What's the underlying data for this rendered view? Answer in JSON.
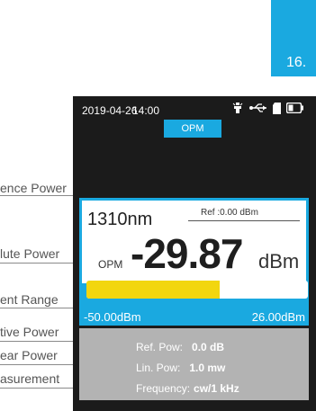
{
  "page": {
    "number": "16."
  },
  "callouts": [
    {
      "label": "ence Power"
    },
    {
      "label": "lute Power"
    },
    {
      "label": "ent Range"
    },
    {
      "label": "tive Power"
    },
    {
      "label": "ear Power"
    },
    {
      "label": "asurement"
    }
  ],
  "status": {
    "date": "2019-04-26",
    "time": "14:00",
    "icons": [
      "light-icon",
      "usb-icon",
      "sd-card-icon",
      "battery-icon"
    ]
  },
  "mode_tab": "OPM",
  "reading": {
    "wavelength": "1310nm",
    "ref": "Ref :0.00  dBm",
    "mode": "OPM",
    "value": "-29.87",
    "unit": "dBm"
  },
  "range": {
    "min": "-50.00dBm",
    "max": "26.00dBm",
    "fill_fraction": 0.6
  },
  "info": [
    {
      "key": "Ref. Pow:",
      "value": "0.0 dB"
    },
    {
      "key": "Lin. Pow:",
      "value": "1.0 mw"
    },
    {
      "key": "Frequency:",
      "value": "cw/1 kHz"
    }
  ],
  "colors": {
    "accent": "#1aa9e0",
    "range_fill": "#f2d60f",
    "info_bg": "#b3b3b3",
    "device_bg": "#1b1b1b"
  }
}
